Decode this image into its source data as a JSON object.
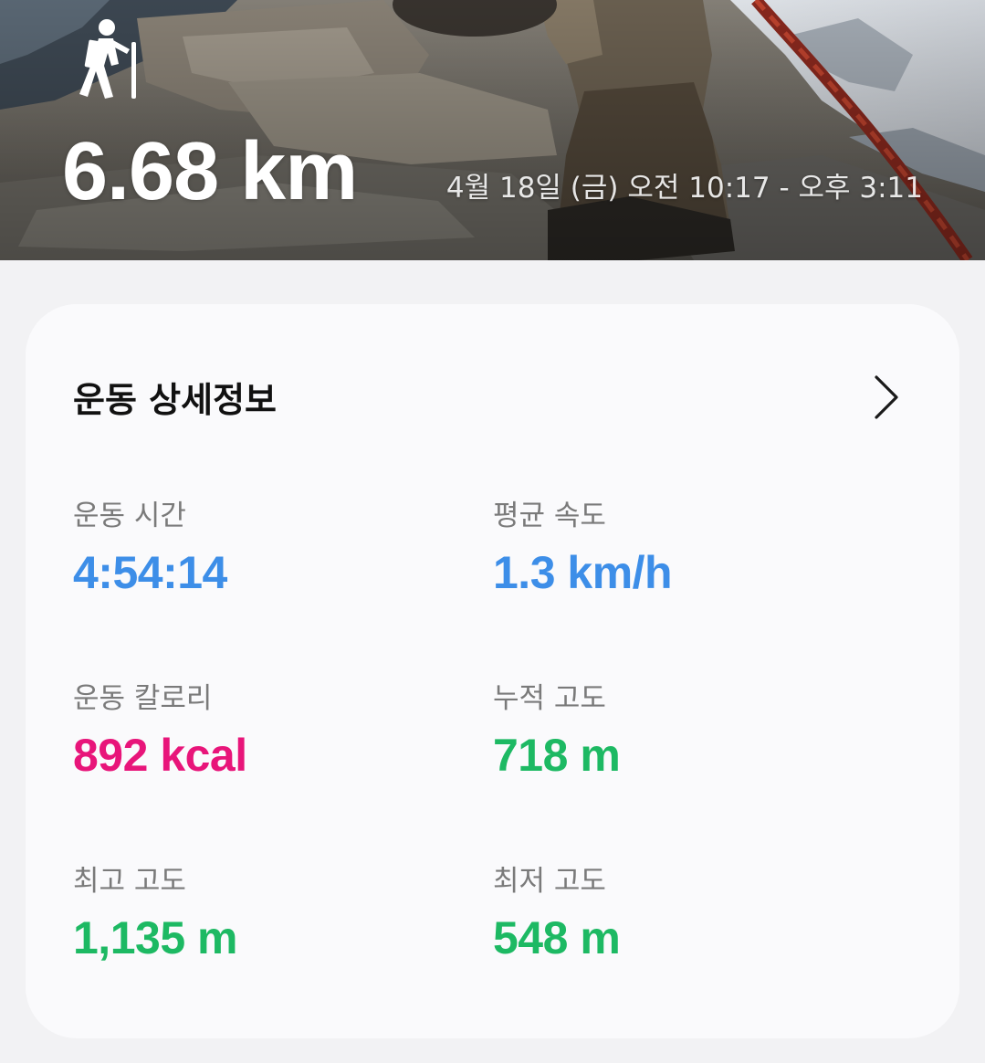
{
  "hero": {
    "activity_icon": "hiking-icon",
    "distance": "6.68 km",
    "date_range": "4월 18일 (금) 오전 10:17 - 오후 3:11"
  },
  "card": {
    "title": "운동 상세정보",
    "chevron_icon": "chevron-right-icon",
    "stats": [
      {
        "label": "운동 시간",
        "value": "4:54:14",
        "color": "#3d8ee8"
      },
      {
        "label": "평균 속도",
        "value": "1.3 km/h",
        "color": "#3d8ee8"
      },
      {
        "label": "운동 칼로리",
        "value": "892 kcal",
        "color": "#e8157a"
      },
      {
        "label": "누적 고도",
        "value": "718 m",
        "color": "#1db963"
      },
      {
        "label": "최고 고도",
        "value": "1,135 m",
        "color": "#1db963"
      },
      {
        "label": "최저 고도",
        "value": "548 m",
        "color": "#1db963"
      }
    ]
  }
}
